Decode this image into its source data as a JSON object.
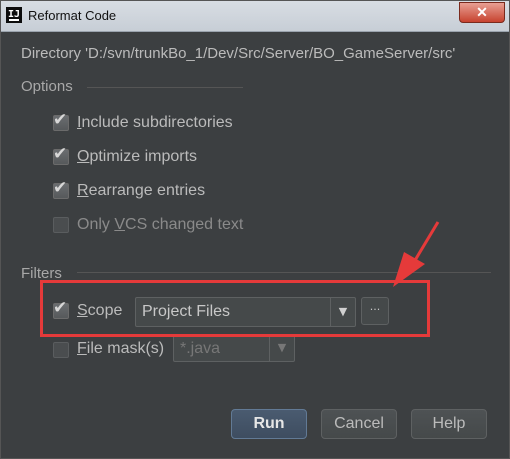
{
  "window": {
    "title": "Reformat Code",
    "close_glyph": "✕"
  },
  "directory_label": "Directory 'D:/svn/trunkBo_1/Dev/Src/Server/BO_GameServer/src'",
  "options": {
    "title": "Options",
    "items": [
      {
        "mnemonic": "I",
        "rest": "nclude subdirectories",
        "checked": true,
        "enabled": true
      },
      {
        "mnemonic": "O",
        "rest": "ptimize imports",
        "checked": true,
        "enabled": true
      },
      {
        "mnemonic": "R",
        "rest": "earrange entries",
        "checked": true,
        "enabled": true
      },
      {
        "prefix": "Only ",
        "mnemonic": "V",
        "rest": "CS changed text",
        "checked": false,
        "enabled": false
      }
    ]
  },
  "filters": {
    "title": "Filters",
    "scope": {
      "mnemonic": "S",
      "rest": "cope",
      "checked": true,
      "value": "Project Files",
      "ellipsis": "···"
    },
    "file_mask": {
      "mnemonic": "F",
      "rest": "ile mask(s)",
      "checked": false,
      "value": "*.java"
    }
  },
  "buttons": {
    "run": "Run",
    "cancel": "Cancel",
    "help": "Help"
  },
  "icons": {
    "app": "intellij-icon",
    "check": "✔",
    "dropdown": "▼"
  },
  "annotation": {
    "color": "#e53a3a"
  }
}
